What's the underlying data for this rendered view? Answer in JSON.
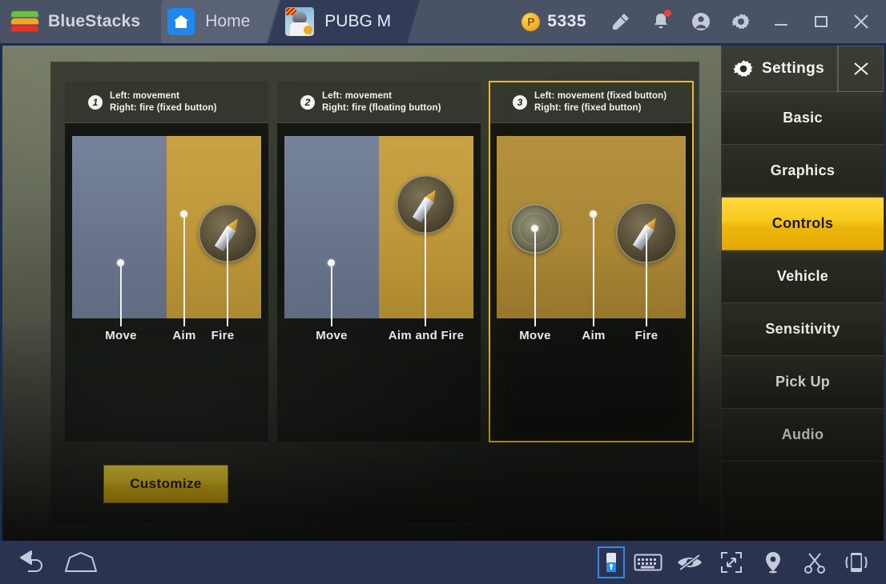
{
  "titlebar": {
    "brand": "BlueStacks",
    "tabs": [
      {
        "label": "Home",
        "icon": "home-icon"
      },
      {
        "label": "PUBG M",
        "icon": "pubg-app-icon"
      }
    ],
    "coin_amount": "5335",
    "coin_symbol": "P",
    "buttons": [
      {
        "name": "brush-icon",
        "label": "Brush"
      },
      {
        "name": "bell-icon",
        "label": "Notifications"
      },
      {
        "name": "account-icon",
        "label": "Account"
      },
      {
        "name": "gear-icon",
        "label": "Settings"
      },
      {
        "name": "minimize-icon",
        "label": "Minimize"
      },
      {
        "name": "maximize-icon",
        "label": "Maximize"
      },
      {
        "name": "close-icon",
        "label": "Close"
      }
    ]
  },
  "game": {
    "customize_label": "Customize",
    "options": [
      {
        "number": "1",
        "line1": "Left: movement",
        "line2": "Right: fire (fixed button)",
        "selected": false,
        "labels": [
          "Move",
          "Aim",
          "Fire"
        ]
      },
      {
        "number": "2",
        "line1": "Left: movement",
        "line2": "Right: fire (floating button)",
        "selected": false,
        "labels": [
          "Move",
          "Aim and Fire"
        ]
      },
      {
        "number": "3",
        "line1": "Left: movement (fixed button)",
        "line2": "Right: fire (fixed button)",
        "selected": true,
        "labels": [
          "Move",
          "Aim",
          "Fire"
        ]
      }
    ]
  },
  "settings": {
    "title": "Settings",
    "close_label": "X",
    "items": [
      {
        "label": "Basic",
        "active": false
      },
      {
        "label": "Graphics",
        "active": false
      },
      {
        "label": "Controls",
        "active": true
      },
      {
        "label": "Vehicle",
        "active": false
      },
      {
        "label": "Sensitivity",
        "active": false
      },
      {
        "label": "Pick Up",
        "active": false
      },
      {
        "label": "Audio",
        "active": false
      }
    ]
  },
  "bottombar": {
    "left": [
      {
        "name": "back-icon",
        "label": "Back"
      },
      {
        "name": "home-nav-icon",
        "label": "Home"
      }
    ],
    "right": [
      {
        "name": "game-controls-icon",
        "label": "Game controls"
      },
      {
        "name": "keyboard-icon",
        "label": "Keyboard"
      },
      {
        "name": "eye-slash-icon",
        "label": "Hide overlay"
      },
      {
        "name": "fullscreen-icon",
        "label": "Fullscreen"
      },
      {
        "name": "location-pin-icon",
        "label": "Location"
      },
      {
        "name": "scissors-icon",
        "label": "Screenshot"
      },
      {
        "name": "shake-phone-icon",
        "label": "Shake"
      }
    ]
  },
  "colors": {
    "accent_yellow": "#f2cf21",
    "selected_border": "#e8b931",
    "titlebar": "#4a5266",
    "bottombar": "#2b3350",
    "zone_move": "#6a758c",
    "zone_aim": "#bd9739"
  }
}
